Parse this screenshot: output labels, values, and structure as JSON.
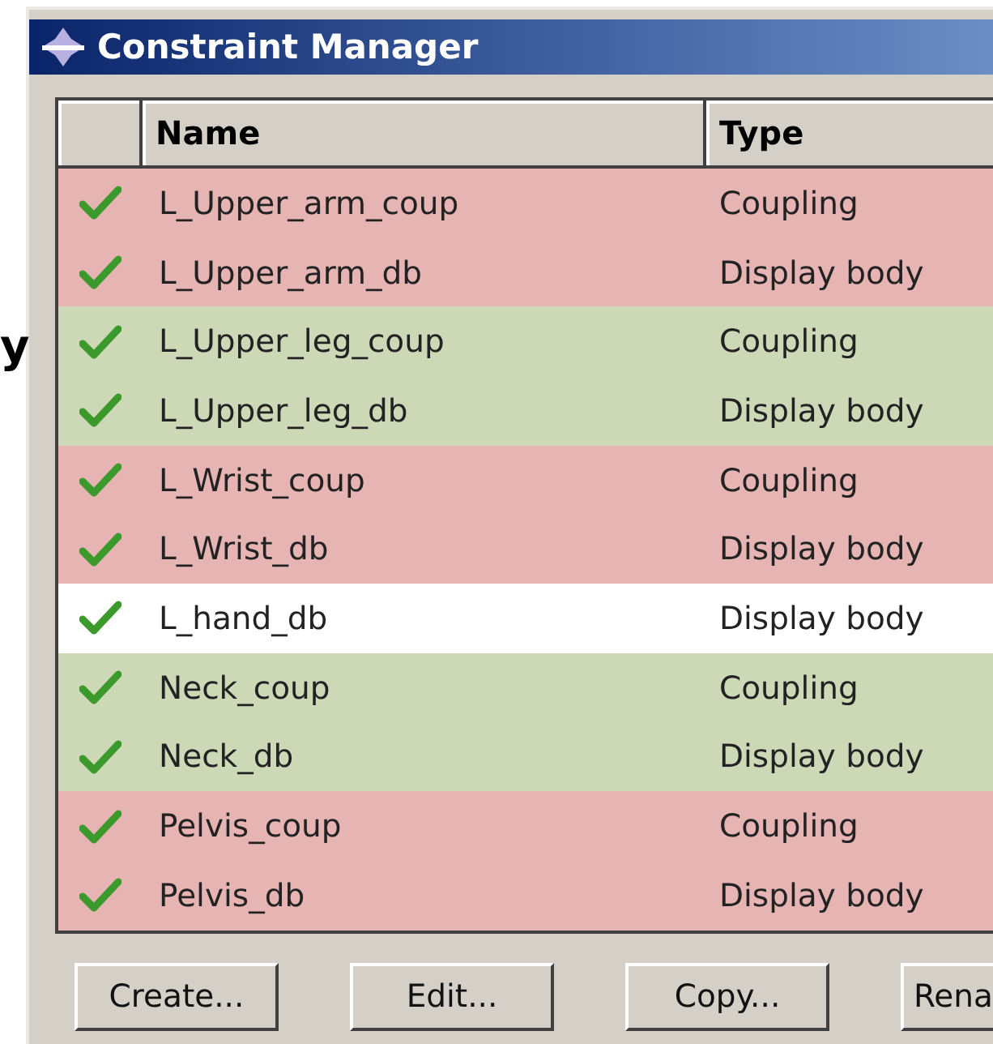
{
  "outside_text": "y",
  "window": {
    "title": "Constraint Manager"
  },
  "table": {
    "columns": [
      "Name",
      "Type"
    ],
    "rows": [
      {
        "checked": true,
        "name": "L_Upper_arm_coup",
        "type": "Coupling",
        "color": "#e6b4b3"
      },
      {
        "checked": true,
        "name": "L_Upper_arm_db",
        "type": "Display body",
        "color": "#e6b4b3"
      },
      {
        "checked": true,
        "name": "L_Upper_leg_coup",
        "type": "Coupling",
        "color": "#cdd8b6"
      },
      {
        "checked": true,
        "name": "L_Upper_leg_db",
        "type": "Display body",
        "color": "#cdd8b6"
      },
      {
        "checked": true,
        "name": "L_Wrist_coup",
        "type": "Coupling",
        "color": "#e6b4b3"
      },
      {
        "checked": true,
        "name": "L_Wrist_db",
        "type": "Display body",
        "color": "#e6b4b3"
      },
      {
        "checked": true,
        "name": "L_hand_db",
        "type": "Display body",
        "color": "#ffffff"
      },
      {
        "checked": true,
        "name": "Neck_coup",
        "type": "Coupling",
        "color": "#cdd8b6"
      },
      {
        "checked": true,
        "name": "Neck_db",
        "type": "Display body",
        "color": "#cdd8b6"
      },
      {
        "checked": true,
        "name": "Pelvis_coup",
        "type": "Coupling",
        "color": "#e6b4b3"
      },
      {
        "checked": true,
        "name": "Pelvis_db",
        "type": "Display body",
        "color": "#e6b4b3"
      }
    ]
  },
  "buttons": [
    "Create...",
    "Edit...",
    "Copy...",
    "Rena"
  ]
}
